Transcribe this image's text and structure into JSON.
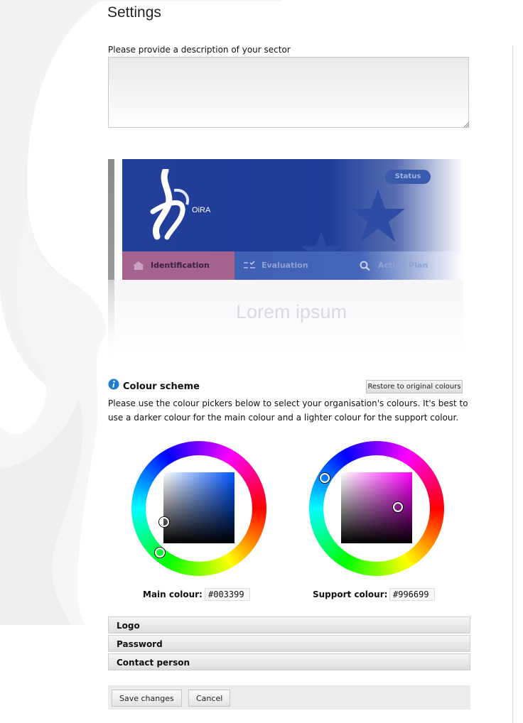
{
  "page": {
    "title": "Settings"
  },
  "description": {
    "label": "Please provide a description of your sector",
    "value": ""
  },
  "preview": {
    "status_label": "Status",
    "logo_text": "OiRA",
    "tabs": [
      {
        "label": "Identification",
        "icon": "home-icon"
      },
      {
        "label": "Evaluation",
        "icon": "checklist-icon"
      },
      {
        "label": "Action Plan",
        "icon": "search-icon"
      }
    ],
    "body_text": "Lorem ipsum"
  },
  "colour_scheme": {
    "title": "Colour scheme",
    "restore_label": "Restore to original colours",
    "description": "Please use the colour pickers below to select your organisation's colours. It's best to use a darker colour for the main colour and a lighter colour for the support colour.",
    "main": {
      "label": "Main colour:",
      "value": "#003399"
    },
    "support": {
      "label": "Support colour:",
      "value": "#996699"
    }
  },
  "sections": [
    "Logo",
    "Password",
    "Contact person"
  ],
  "actions": {
    "save_label": "Save changes",
    "cancel_label": "Cancel"
  }
}
